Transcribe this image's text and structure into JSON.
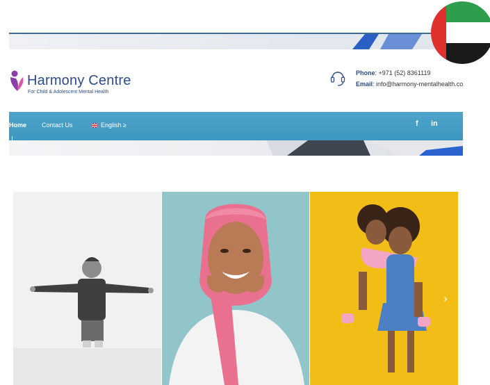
{
  "header": {
    "brand_name": "Harmony Centre",
    "brand_subtitle": "For Child & Adolescent Mental Health",
    "phone_label": "Phone",
    "phone_value": ": +971 (52) 8361119",
    "email_label": "Email",
    "email_value": ": info@harmony-mentalhealth.co"
  },
  "nav": {
    "items": [
      {
        "label": "Home"
      },
      {
        "label": "Contact Us"
      },
      {
        "label": "English ≥"
      }
    ],
    "social": {
      "facebook": "f",
      "linkedin": "in"
    }
  },
  "gallery": {
    "next_arrow": "›"
  },
  "icons": {
    "logo": "harmony-logo-icon",
    "headset": "headset-icon",
    "flag_language": "uk-flag-icon",
    "flag_country": "uae-flag-icon"
  },
  "colors": {
    "brand_blue": "#2c4b8c",
    "nav_blue": "#4ea3c9",
    "logo_purple": "#8a3fa8",
    "gallery_yellow": "#f2bd16",
    "gallery_teal": "#8fc3c9"
  }
}
